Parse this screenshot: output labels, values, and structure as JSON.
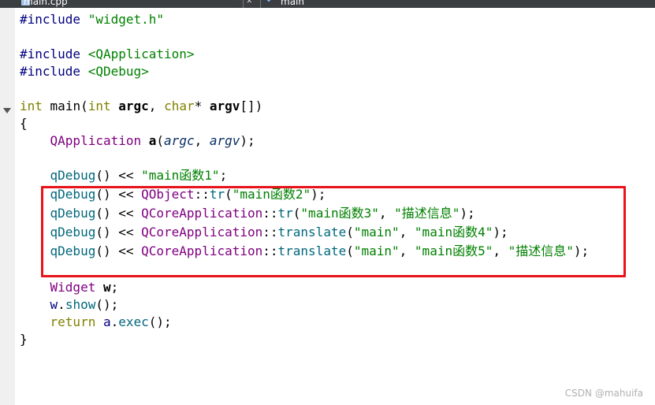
{
  "tabs": {
    "file_tab": "main.cpp",
    "function_tab": "main"
  },
  "code": {
    "l1_pp": "#include",
    "l1_str": "\"widget.h\"",
    "l3_pp": "#include",
    "l3_inc": "<QApplication>",
    "l4_pp": "#include",
    "l4_inc": "<QDebug>",
    "l6_kw1": "int",
    "l6_fn": "main",
    "l6_p1": "(",
    "l6_kw2": "int",
    "l6_arg1": "argc",
    "l6_comma": ", ",
    "l6_kw3": "char",
    "l6_star": "* ",
    "l6_arg2": "argv",
    "l6_end": "[])",
    "l7": "{",
    "l8_type": "QApplication",
    "l8_var": "a",
    "l8_p1": "(",
    "l8_a1": "argc",
    "l8_comma": ", ",
    "l8_a2": "argv",
    "l8_end": ");",
    "l10_fn": "qDebug",
    "l10_op": "() << ",
    "l10_str": "\"main函数1\"",
    "l10_end": ";",
    "l11_fn": "qDebug",
    "l11_op": "() << ",
    "l11_type": "QObject",
    "l11_sep": "::",
    "l11_fn2": "tr",
    "l11_p": "(",
    "l11_str": "\"main函数2\"",
    "l11_end": ");",
    "l12_fn": "qDebug",
    "l12_op": "() << ",
    "l12_type": "QCoreApplication",
    "l12_sep": "::",
    "l12_fn2": "tr",
    "l12_p": "(",
    "l12_str1": "\"main函数3\"",
    "l12_comma": ", ",
    "l12_str2": "\"描述信息\"",
    "l12_end": ");",
    "l13_fn": "qDebug",
    "l13_op": "() << ",
    "l13_type": "QCoreApplication",
    "l13_sep": "::",
    "l13_fn2": "translate",
    "l13_p": "(",
    "l13_str1": "\"main\"",
    "l13_comma": ", ",
    "l13_str2": "\"main函数4\"",
    "l13_end": ");",
    "l14_fn": "qDebug",
    "l14_op": "() << ",
    "l14_type": "QCoreApplication",
    "l14_sep": "::",
    "l14_fn2": "translate",
    "l14_p": "(",
    "l14_str1": "\"main\"",
    "l14_comma1": ", ",
    "l14_str2": "\"main函数5\"",
    "l14_comma2": ", ",
    "l14_str3": "\"描述信息\"",
    "l14_end": ");",
    "l16_type": "Widget",
    "l16_var": "w",
    "l16_end": ";",
    "l17_var": "w",
    "l17_dot": ".",
    "l17_fn": "show",
    "l17_end": "();",
    "l18_kw": "return",
    "l18_var": " a",
    "l18_dot": ".",
    "l18_fn": "exec",
    "l18_end": "();",
    "l19": "}"
  },
  "watermark": "CSDN @mahuifa",
  "colors": {
    "highlight_border": "#e8141c",
    "keyword": "#808000",
    "string": "#008000",
    "type": "#800080",
    "function": "#00677c"
  }
}
